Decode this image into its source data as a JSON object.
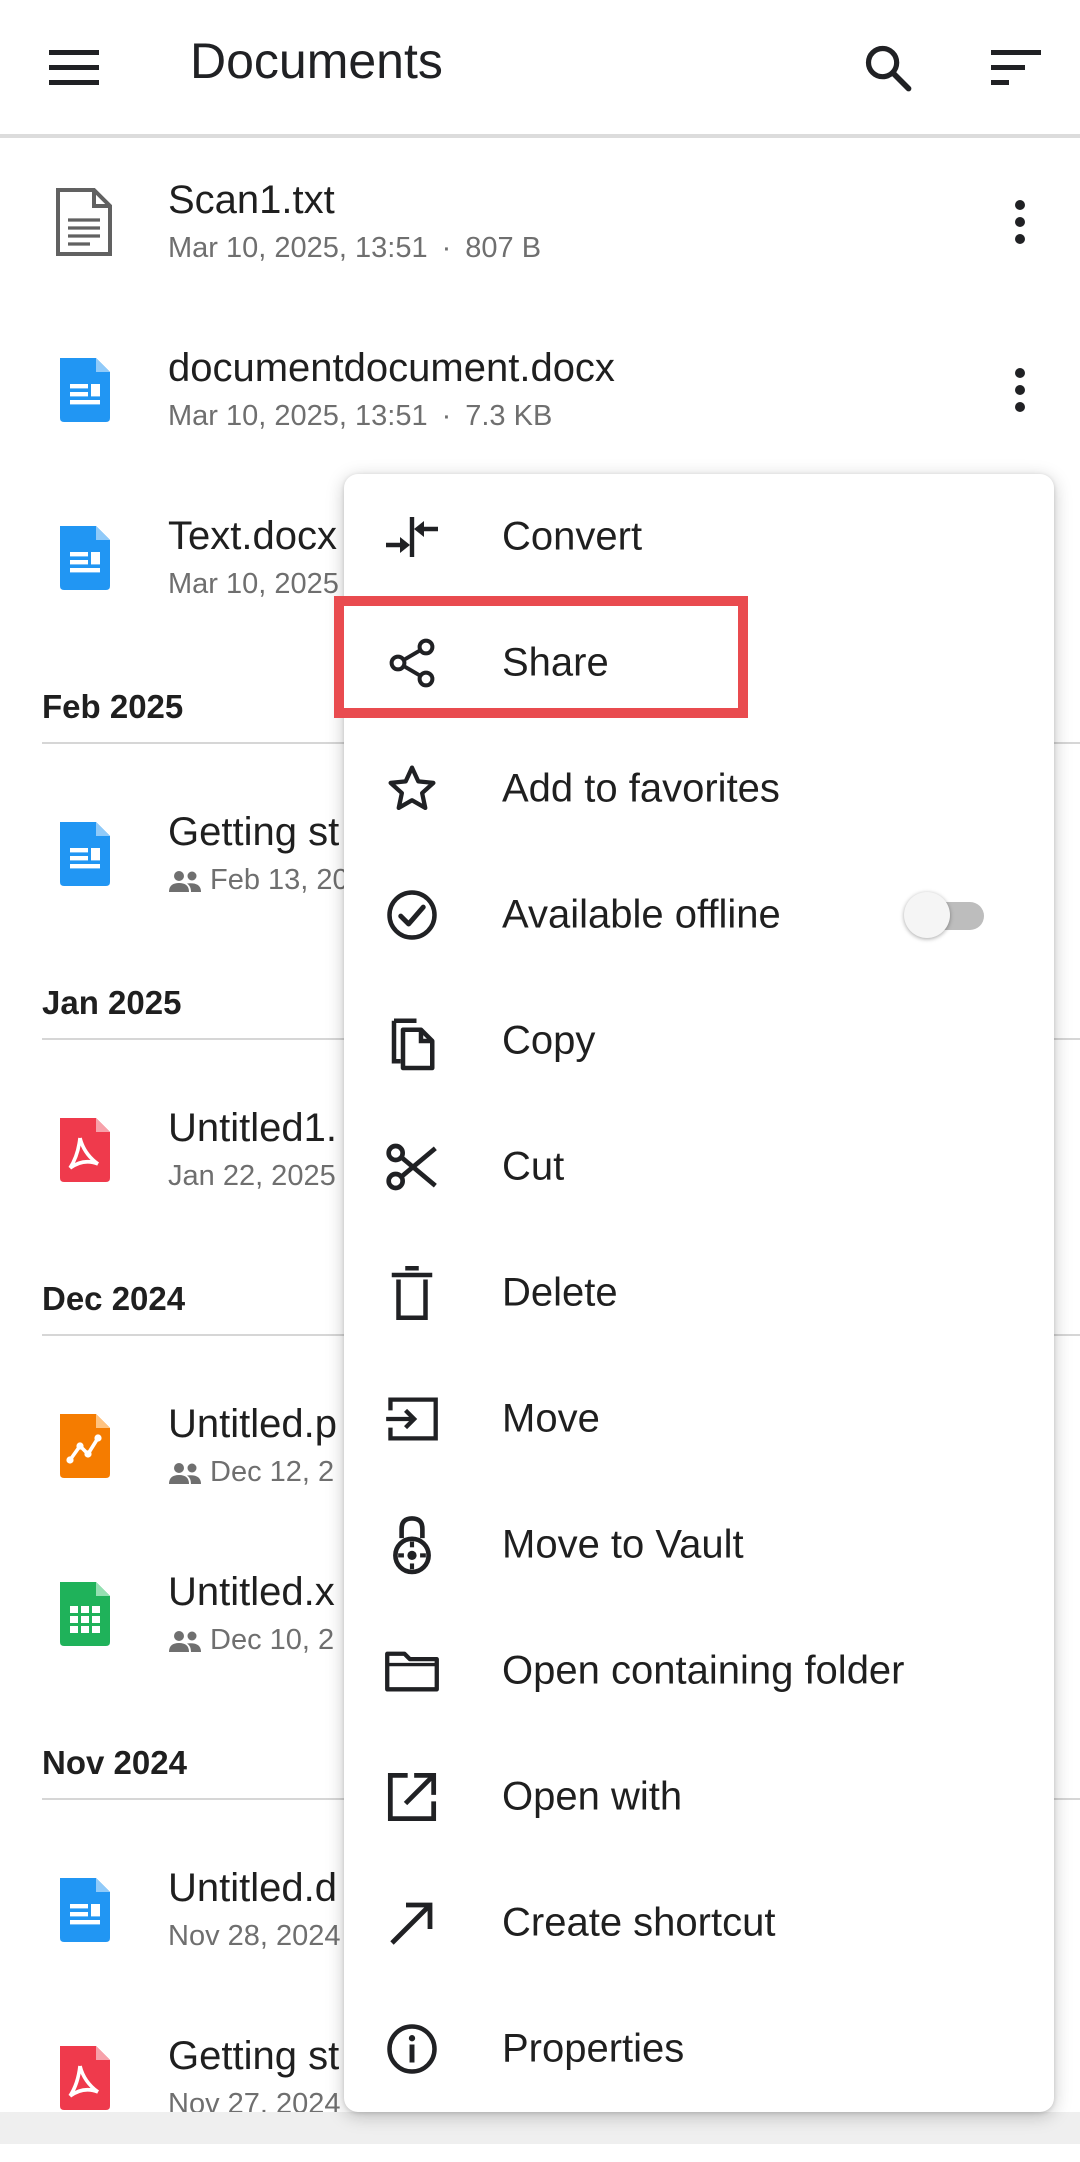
{
  "appbar": {
    "title": "Documents",
    "menu_icon": "hamburger-menu-icon",
    "search_icon": "search-icon",
    "sort_icon": "sort-icon"
  },
  "files": {
    "scan1": {
      "name": "Scan1.txt",
      "date": "Mar 10, 2025, 13:51",
      "size": "807 B",
      "icon": "text-file-icon"
    },
    "documentdocument": {
      "name": "documentdocument.docx",
      "date": "Mar 10, 2025, 13:51",
      "size": "7.3 KB",
      "icon": "docx-file-icon"
    },
    "text_docx": {
      "name": "Text.docx",
      "date": "Mar 10, 2025",
      "icon": "docx-file-icon"
    },
    "getting_started": {
      "name": "Getting st",
      "date": "Feb 13, 20",
      "icon": "docx-file-icon"
    },
    "untitled1": {
      "name": "Untitled1.",
      "date": "Jan 22, 2025",
      "icon": "pdf-file-icon"
    },
    "untitled_p": {
      "name": "Untitled.p",
      "date": "Dec 12, 2",
      "icon": "presentation-file-icon"
    },
    "untitled_x": {
      "name": "Untitled.x",
      "date": "Dec 10, 2",
      "icon": "spreadsheet-file-icon"
    },
    "untitled_d": {
      "name": "Untitled.d",
      "date": "Nov 28, 2024",
      "icon": "docx-file-icon"
    },
    "getting_st2": {
      "name": "Getting st",
      "date": "Nov 27, 2024",
      "icon": "pdf-file-icon"
    }
  },
  "sections": {
    "feb2025": "Feb 2025",
    "jan2025": "Jan 2025",
    "dec2024": "Dec 2024",
    "nov2024": "Nov 2024"
  },
  "meta_separator": "·",
  "menu": {
    "convert": "Convert",
    "share": "Share",
    "favorites": "Add to favorites",
    "offline": "Available offline",
    "offline_enabled": false,
    "copy": "Copy",
    "cut": "Cut",
    "delete": "Delete",
    "move": "Move",
    "vault": "Move to Vault",
    "open_folder": "Open containing folder",
    "open_with": "Open with",
    "shortcut": "Create shortcut",
    "properties": "Properties"
  },
  "colors": {
    "docx": "#2196f3",
    "pdf": "#ef3a4c",
    "presentation": "#f57c00",
    "spreadsheet": "#1fb25a",
    "highlight": "#e94b4f"
  }
}
